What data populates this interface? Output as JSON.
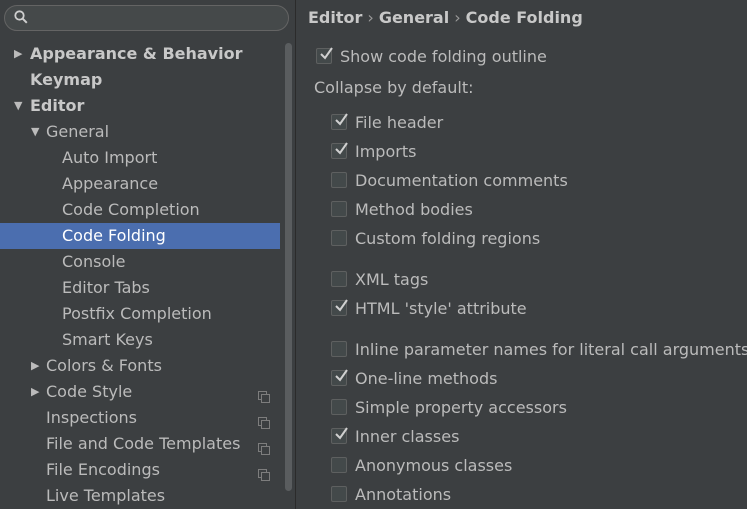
{
  "search": {
    "placeholder": ""
  },
  "tree": {
    "items": [
      {
        "label": "Appearance & Behavior",
        "expanded": false,
        "has_arrow": true,
        "bold": true,
        "depth": 0,
        "name": "appearance-behavior"
      },
      {
        "label": "Keymap",
        "has_arrow": false,
        "bold": true,
        "depth": 0,
        "name": "keymap"
      },
      {
        "label": "Editor",
        "expanded": true,
        "has_arrow": true,
        "bold": true,
        "depth": 0,
        "name": "editor"
      },
      {
        "label": "General",
        "expanded": true,
        "has_arrow": true,
        "bold": false,
        "depth": 1,
        "name": "general"
      },
      {
        "label": "Auto Import",
        "has_arrow": false,
        "depth": 2,
        "name": "auto-import"
      },
      {
        "label": "Appearance",
        "has_arrow": false,
        "depth": 2,
        "name": "appearance"
      },
      {
        "label": "Code Completion",
        "has_arrow": false,
        "depth": 2,
        "name": "code-completion"
      },
      {
        "label": "Code Folding",
        "has_arrow": false,
        "depth": 2,
        "selected": true,
        "name": "code-folding"
      },
      {
        "label": "Console",
        "has_arrow": false,
        "depth": 2,
        "name": "console"
      },
      {
        "label": "Editor Tabs",
        "has_arrow": false,
        "depth": 2,
        "name": "editor-tabs"
      },
      {
        "label": "Postfix Completion",
        "has_arrow": false,
        "depth": 2,
        "name": "postfix-completion"
      },
      {
        "label": "Smart Keys",
        "has_arrow": false,
        "depth": 2,
        "name": "smart-keys"
      },
      {
        "label": "Colors & Fonts",
        "expanded": false,
        "has_arrow": true,
        "depth": 1,
        "name": "colors-fonts"
      },
      {
        "label": "Code Style",
        "expanded": false,
        "has_arrow": true,
        "depth": 1,
        "badge": true,
        "name": "code-style"
      },
      {
        "label": "Inspections",
        "has_arrow": false,
        "depth": 1,
        "badge": true,
        "name": "inspections"
      },
      {
        "label": "File and Code Templates",
        "has_arrow": false,
        "depth": 1,
        "badge": true,
        "name": "file-code-templates"
      },
      {
        "label": "File Encodings",
        "has_arrow": false,
        "depth": 1,
        "badge": true,
        "name": "file-encodings"
      },
      {
        "label": "Live Templates",
        "has_arrow": false,
        "depth": 1,
        "name": "live-templates"
      }
    ]
  },
  "breadcrumb": {
    "part1": "Editor",
    "part2": "General",
    "part3": "Code Folding",
    "separator": "›"
  },
  "main": {
    "show_outline": {
      "label": "Show code folding outline",
      "checked": true
    },
    "collapse_label": "Collapse by default:",
    "options": [
      {
        "label": "File header",
        "checked": true,
        "name": "file-header"
      },
      {
        "label": "Imports",
        "checked": true,
        "name": "imports"
      },
      {
        "label": "Documentation comments",
        "checked": false,
        "name": "documentation-comments"
      },
      {
        "label": "Method bodies",
        "checked": false,
        "name": "method-bodies"
      },
      {
        "label": "Custom folding regions",
        "checked": false,
        "name": "custom-folding-regions"
      },
      {
        "label": "XML tags",
        "checked": false,
        "name": "xml-tags"
      },
      {
        "label": "HTML 'style' attribute",
        "checked": true,
        "name": "html-style-attribute"
      },
      {
        "label": "Inline parameter names for literal call arguments",
        "checked": false,
        "name": "inline-parameter-names"
      },
      {
        "label": "One-line methods",
        "checked": true,
        "name": "one-line-methods"
      },
      {
        "label": "Simple property accessors",
        "checked": false,
        "name": "simple-property-accessors"
      },
      {
        "label": "Inner classes",
        "checked": true,
        "name": "inner-classes"
      },
      {
        "label": "Anonymous classes",
        "checked": false,
        "name": "anonymous-classes"
      },
      {
        "label": "Annotations",
        "checked": false,
        "name": "annotations"
      }
    ]
  },
  "colors": {
    "selection": "#4b6eaf",
    "background": "#3c3f41"
  }
}
